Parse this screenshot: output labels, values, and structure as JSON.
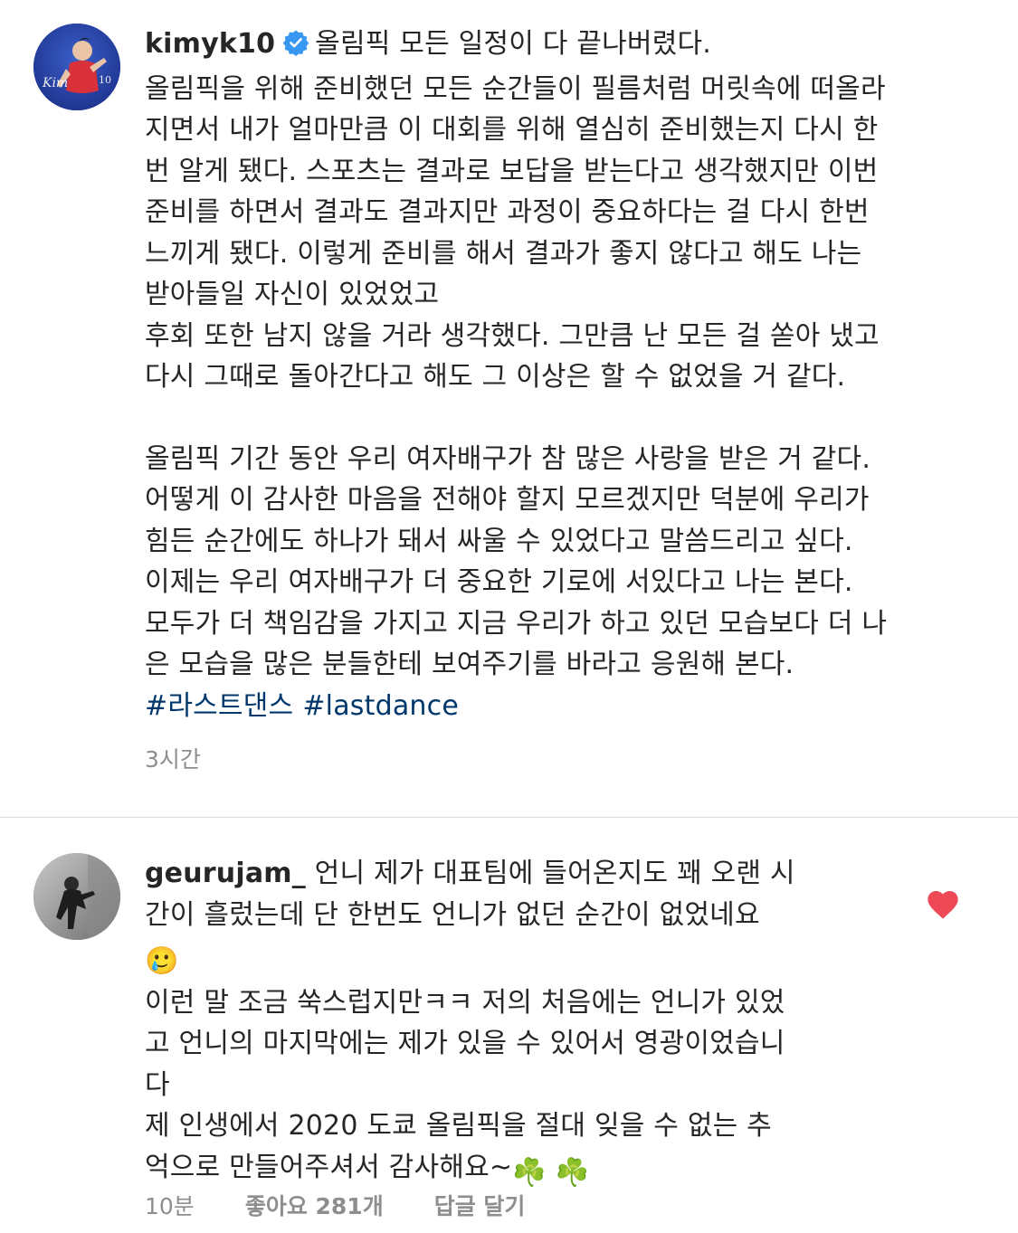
{
  "post": {
    "username": "kimyk10",
    "first_line": "올림픽 모든 일정이 다 끝나버렸다.",
    "paragraphs": [
      "올림픽을 위해 준비했던 모든 순간들이 필름처럼 머릿속에 떠올라\n지면서 내가 얼마만큼 이 대회를 위해 열심히 준비했는지 다시 한\n번 알게 됐다. 스포츠는 결과로 보답을 받는다고 생각했지만 이번\n준비를 하면서 결과도 결과지만 과정이 중요하다는 걸 다시 한번\n느끼게 됐다. 이렇게 준비를 해서 결과가 좋지 않다고 해도 나는\n받아들일 자신이 있었었고",
      "후회 또한 남지 않을 거라 생각했다. 그만큼 난 모든 걸 쏟아 냈고\n다시 그때로 돌아간다고 해도 그 이상은 할 수 없었을 거 같다.",
      "올림픽 기간 동안 우리 여자배구가 참 많은 사랑을 받은 거 같다.\n어떻게 이 감사한 마음을 전해야 할지 모르겠지만 덕분에 우리가\n힘든 순간에도 하나가 돼서 싸울 수 있었다고 말씀드리고 싶다.\n이제는 우리 여자배구가 더 중요한 기로에 서있다고 나는 본다.\n모두가 더 책임감을 가지고 지금 우리가 하고 있던 모습보다 더 나\n은 모습을 많은 분들한테 보여주기를 바라고 응원해 본다."
    ],
    "hashtags": [
      "#라스트댄스",
      "#lastdance"
    ],
    "time": "3시간",
    "verified_icon": "verified-badge-icon",
    "accent": "#3897f0"
  },
  "reply": {
    "username": "geurujam_",
    "line1": "언니 제가 대표팀에 들어온지도 꽤 오랜 시\n간이 흘렀는데 단 한번도 언니가 없던 순간이 없었네요",
    "emoji_tear": "🥲",
    "line2": "이런 말 조금 쑥스럽지만ㅋㅋ 저의 처음에는 언니가 있었\n고 언니의 마지막에는 제가 있을 수 있어서 영광이었습니\n다\n제 인생에서 2020 도쿄 올림픽을 절대 잊을 수 없는 추\n억으로 만들어주셔서 감사해요~",
    "emoji_clover": "☘️ ☘️",
    "time": "10분",
    "likes": "좋아요 281개",
    "reply_label": "답글 달기",
    "heart_color": "#ed4956"
  }
}
